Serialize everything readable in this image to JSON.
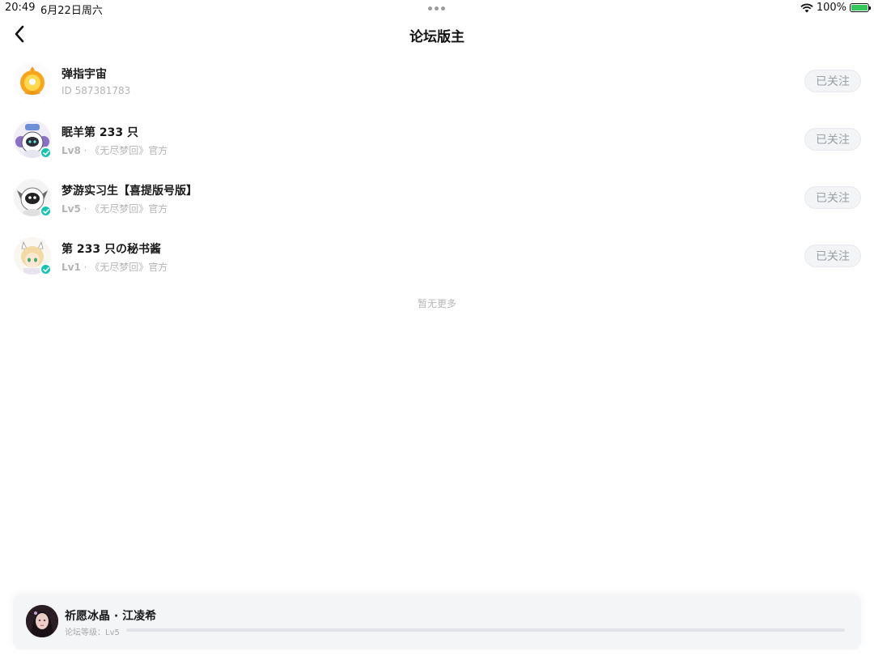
{
  "status_bar": {
    "time": "20:49",
    "date": "6月22日周六",
    "battery": "100%"
  },
  "header": {
    "title": "论坛版主"
  },
  "moderators": [
    {
      "name": "弹指宇宙",
      "sub_level": "",
      "sub_text": "ID 587381783",
      "verified": false,
      "follow_label": "已关注"
    },
    {
      "name": "眠羊第 233 只",
      "sub_level": "Lv8",
      "sub_text": " · 《无尽梦回》官方",
      "verified": true,
      "follow_label": "已关注"
    },
    {
      "name": "梦游实习生【喜提版号版】",
      "sub_level": "Lv5",
      "sub_text": " · 《无尽梦回》官方",
      "verified": true,
      "follow_label": "已关注"
    },
    {
      "name": "第 233 只の秘书酱",
      "sub_level": "Lv1",
      "sub_text": " · 《无尽梦回》官方",
      "verified": true,
      "follow_label": "已关注"
    }
  ],
  "list_footer": "暂无更多",
  "bottom_card": {
    "name": "祈愿冰晶 · 江凌希",
    "level_text": "论坛等级：Lv5",
    "progress": 0.0
  },
  "colors": {
    "verified_badge": "#16c3b3",
    "battery_fill": "#34c759"
  }
}
